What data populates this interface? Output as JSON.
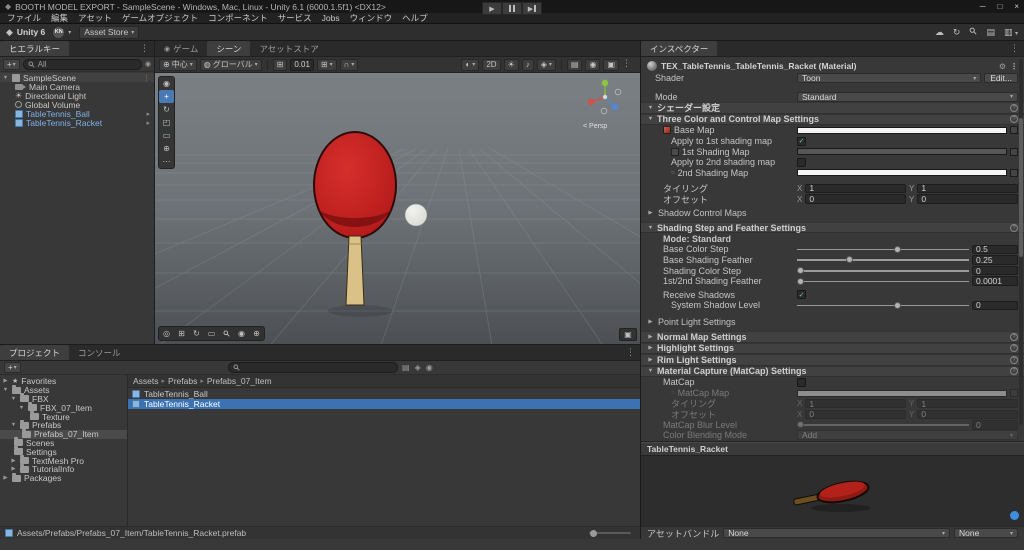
{
  "colors": {
    "selection_blue": "#3a72b4",
    "prefab_text_blue": "#7fb2e5",
    "checkbox_teal": "#6fc7c0",
    "paddle_red": "#b81d1c"
  },
  "icons": {
    "unity_logo": "◆",
    "caret_down": "▾",
    "fold_open": "▼",
    "fold_closed": "▶",
    "more": "⋮",
    "check": "✓",
    "star": "★",
    "play": "▶",
    "cloud": "☁",
    "history": "↻",
    "layers": "▤",
    "layout": "▥",
    "minimize": "─",
    "maximize": "□",
    "close": "×",
    "breadcrumb_sep": "▸",
    "prefab_chevron": "▸",
    "gear": "⚙",
    "help": "?",
    "plus": "+",
    "light": "☀",
    "audio": "♪",
    "effects": "◈",
    "shaded": "◐",
    "eye": "◉",
    "pivot": "⊕",
    "globe": "◍",
    "grid": "⊞",
    "magnet": "∩",
    "camera": "▣",
    "circle": "○",
    "tool_view": "◉",
    "tool_move": "+",
    "tool_rotate": "↻",
    "tool_scale": "◰",
    "tool_rect": "▭",
    "tool_transform": "⊕",
    "tool_more": "⋯",
    "overlay_orbit": "◎",
    "overlay_grid": "⊞",
    "overlay_rotate": "↻",
    "overlay_rect": "▭",
    "overlay_target": "◉",
    "overlay_plus": "⊕",
    "console": "▤",
    "activity": "↻"
  },
  "window": {
    "title": "BOOTH MODEL EXPORT - SampleScene - Windows, Mac, Linux - Unity 6.1 (6000.1.5f1) <DX12>"
  },
  "menu": {
    "items": [
      "ファイル",
      "編集",
      "アセット",
      "ゲームオブジェクト",
      "コンポーネント",
      "サービス",
      "Jobs",
      "ウィンドウ",
      "ヘルプ"
    ]
  },
  "toolbar": {
    "brand": "Unity 6",
    "account_initials": "KN",
    "asset_store": "Asset Store"
  },
  "hierarchy": {
    "tab": "ヒエラルキー",
    "search_text": "All",
    "scene_name": "SampleScene",
    "items": [
      "Main Camera",
      "Directional Light",
      "Global Volume",
      "TableTennis_Ball",
      "TableTennis_Racket"
    ]
  },
  "scene_view": {
    "tab_game": "ゲーム",
    "tab_scene": "シーン",
    "tab_asset_store": "アセットストア",
    "pivot": "中心",
    "orientation": "グローバル",
    "grid_size": "0.01",
    "two_d": "2D",
    "persp_label": "< Persp"
  },
  "project": {
    "tab_project": "プロジェクト",
    "tab_console": "コンソール",
    "favorites": "Favorites",
    "tree": [
      "Assets",
      "FBX",
      "FBX_07_Item",
      "Texture",
      "Prefabs",
      "Prefabs_07_Item",
      "Scenes",
      "Settings",
      "TextMesh Pro",
      "TutorialInfo",
      "Packages"
    ],
    "breadcrumb": [
      "Assets",
      "Prefabs",
      "Prefabs_07_Item"
    ],
    "files": [
      "TableTennis_Ball",
      "TableTennis_Racket"
    ],
    "selected_path": "Assets/Prefabs/Prefabs_07_Item/TableTennis_Racket.prefab"
  },
  "inspector": {
    "tab": "インスペクター",
    "material_name": "TEX_TableTennis_TableTennis_Racket (Material)",
    "shader": {
      "label": "Shader",
      "value": "Toon",
      "edit": "Edit..."
    },
    "mode": {
      "label": "Mode",
      "value": "Standard"
    },
    "sections": {
      "shader_settings": "シェーダー設定",
      "three_color": "Three Color and Control Map Settings",
      "shadow_control": "Shadow Control Maps",
      "shading_step": "Shading Step and Feather Settings",
      "point_light": "Point Light Settings",
      "normal_map": "Normal Map Settings",
      "highlight": "Highlight Settings",
      "rim_light": "Rim Light Settings",
      "matcap": "Material Capture (MatCap) Settings"
    },
    "rows": {
      "base_map": "Base Map",
      "apply_1st": "Apply to 1st shading map",
      "first_map": "1st Shading Map",
      "apply_2nd": "Apply to 2nd shading map",
      "second_map": "2nd Shading Map",
      "tiling": "タイリング",
      "offset": "オフセット",
      "x": "X",
      "y": "Y",
      "tiling_x": "1",
      "tiling_y": "1",
      "offset_x": "0",
      "offset_y": "0",
      "shading_mode": "Mode: Standard",
      "receive_shadows": "Receive Shadows",
      "matcap_toggle": "MatCap",
      "matcap_map": "MatCap Map",
      "blend_label": "Color Blending Mode",
      "blend_value": "Add"
    },
    "sliders": {
      "base_color_step": {
        "label": "Base Color Step",
        "value": "0.5"
      },
      "base_shading_feather": {
        "label": "Base Shading Feather",
        "value": "0.25"
      },
      "shading_color_step": {
        "label": "Shading Color Step",
        "value": "0"
      },
      "feather_12": {
        "label": "1st/2nd Shading Feather",
        "value": "0.0001"
      },
      "system_shadow": {
        "label": "System Shadow Level",
        "value": "0"
      },
      "matcap_blur": {
        "label": "MatCap Blur Level",
        "value": "0"
      }
    },
    "preview_title": "TableTennis_Racket",
    "asset_bundle": {
      "label": "アセットバンドル",
      "bundle": "None",
      "variant": "None"
    }
  }
}
